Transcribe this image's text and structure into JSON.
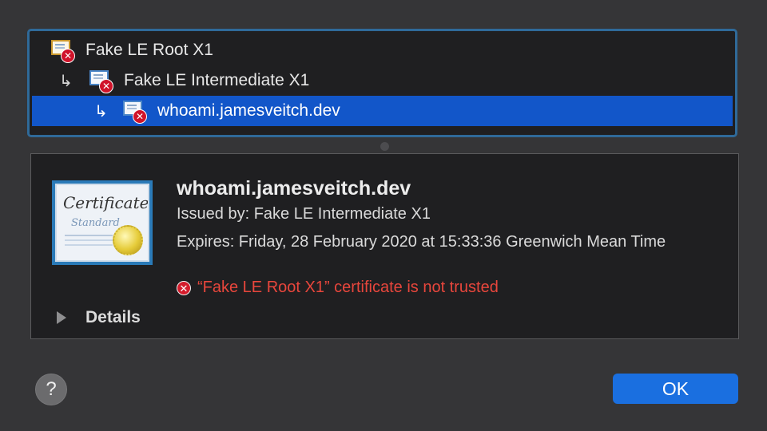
{
  "chain": {
    "items": [
      {
        "label": "Fake LE Root X1",
        "icon": "cert-error-icon",
        "arrow": ""
      },
      {
        "label": "Fake LE Intermediate X1",
        "icon": "cert-error-icon",
        "arrow": "↳"
      },
      {
        "label": "whoami.jamesveitch.dev",
        "icon": "cert-error-icon",
        "arrow": "↳"
      }
    ],
    "selected_index": 2
  },
  "certificate": {
    "art_title": "Certificate",
    "art_subtitle": "Standard",
    "name": "whoami.jamesveitch.dev",
    "issued_by": "Issued by: Fake LE Intermediate X1",
    "expires": "Expires: Friday, 28 February 2020 at 15:33:36 Greenwich Mean Time",
    "warning": "“Fake LE Root X1” certificate is not trusted"
  },
  "details": {
    "label": "Details"
  },
  "buttons": {
    "help": "?",
    "ok": "OK"
  },
  "colors": {
    "selection": "#1256c9",
    "warning": "#e8463c",
    "ok_button": "#1a6fe0",
    "focus_ring": "#2f6a99"
  }
}
